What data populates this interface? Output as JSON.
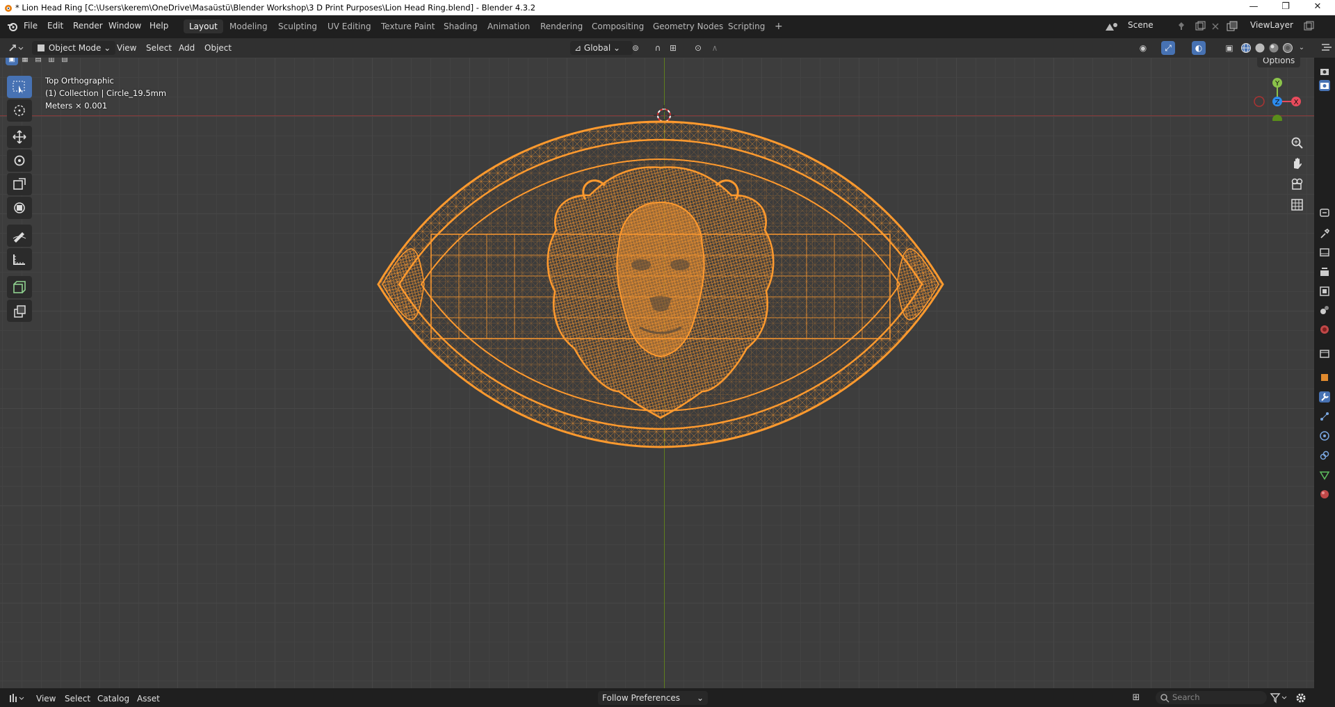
{
  "window": {
    "title": "* Lion Head Ring [C:\\Users\\kerem\\OneDrive\\Masaüstü\\Blender Workshop\\3 D Print Purposes\\Lion Head Ring.blend] - Blender 4.3.2",
    "minimize": "—",
    "maximize": "❐",
    "close": "✕"
  },
  "menu": {
    "items": [
      "File",
      "Edit",
      "Render",
      "Window",
      "Help"
    ]
  },
  "workspaces": {
    "tabs": [
      "Layout",
      "Modeling",
      "Sculpting",
      "UV Editing",
      "Texture Paint",
      "Shading",
      "Animation",
      "Rendering",
      "Compositing",
      "Geometry Nodes",
      "Scripting"
    ],
    "active": "Layout",
    "add": "+"
  },
  "scene": {
    "name": "Scene",
    "view_layer": "ViewLayer"
  },
  "header": {
    "mode": "Object Mode",
    "menus": [
      "View",
      "Select",
      "Add",
      "Object"
    ],
    "orientation": "Global",
    "options": "Options"
  },
  "viewport": {
    "view_name": "Top Orthographic",
    "collection": "(1) Collection | Circle_19.5mm",
    "units": "Meters × 0.001",
    "gizmo": {
      "y": "Y",
      "z": "Z",
      "x": "X"
    },
    "wire_color": "#ff9a2e",
    "accent_color": "#4772b3"
  },
  "tools": [
    "select-box",
    "cursor",
    "move",
    "rotate",
    "scale",
    "transform",
    "annotate",
    "measure",
    "add-cube",
    "extrude"
  ],
  "status": {
    "menus": [
      "View",
      "Select",
      "Catalog",
      "Asset"
    ],
    "preference": "Follow Preferences",
    "search_placeholder": "Search"
  }
}
